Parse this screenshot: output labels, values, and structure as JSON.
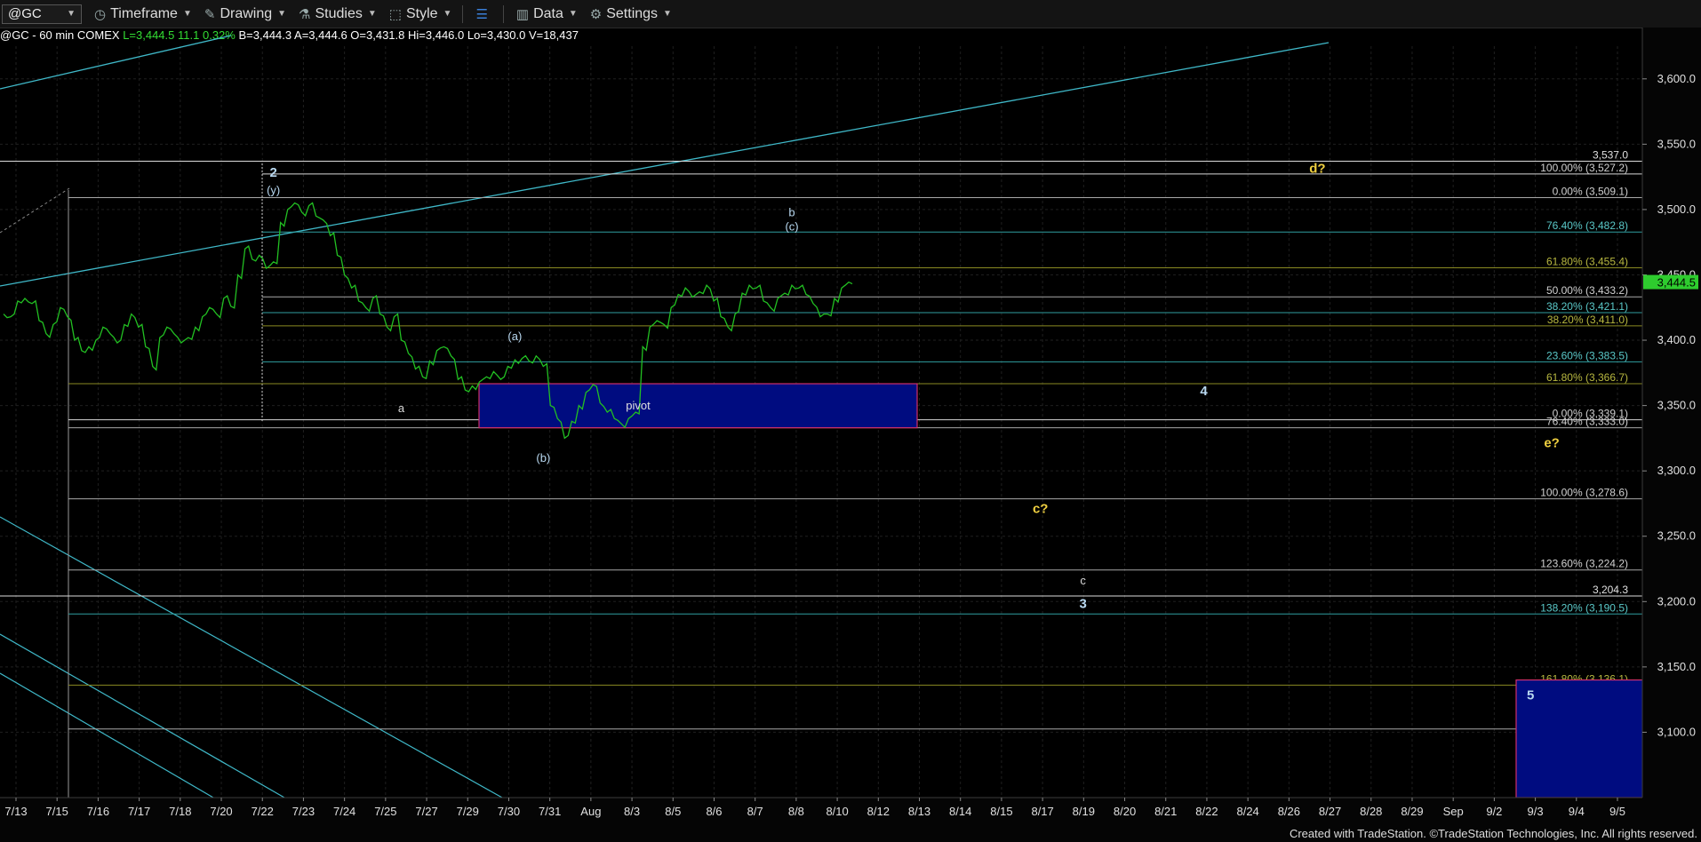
{
  "toolbar": {
    "symbol": "@GC",
    "timeframe": "Timeframe",
    "drawing": "Drawing",
    "studies": "Studies",
    "style": "Style",
    "data": "Data",
    "settings": "Settings"
  },
  "infobar": {
    "title": "@GC - 60 min  COMEX",
    "last": "L=3,444.5",
    "change": "11.1",
    "pct": "0.32%",
    "bid": "B=3,444.3",
    "ask": "A=3,444.6",
    "open": "O=3,431.8",
    "high": "Hi=3,446.0",
    "low": "Lo=3,430.0",
    "volume": "V=18,437"
  },
  "footer": "Created with TradeStation. ©TradeStation Technologies, Inc. All rights reserved.",
  "colors": {
    "price": "#22c022",
    "fib_teal": "#2f9ea0",
    "fib_olive": "#8a8a22",
    "fib_grey": "#a8a8a8",
    "channel": "#3fb8c8",
    "label_yellow": "#f0d040",
    "label_blue": "#b8d8f0",
    "box_fill": "#000c80",
    "box_border": "#d0306a",
    "last_price_bg": "#2ecc2e"
  },
  "chart_data": {
    "type": "line",
    "title": "",
    "ylim": [
      3050,
      3625
    ],
    "y_ticks": [
      "3,600.0",
      "3,550.0",
      "3,500.0",
      "3,450.0",
      "3,400.0",
      "3,350.0",
      "3,300.0",
      "3,250.0",
      "3,200.0",
      "3,150.0",
      "3,100.0"
    ],
    "y_tick_values": [
      3600,
      3550,
      3500,
      3450,
      3400,
      3350,
      3300,
      3250,
      3200,
      3150,
      3100
    ],
    "x_ticks": [
      "7/13",
      "7/15",
      "7/16",
      "7/17",
      "7/18",
      "7/20",
      "7/22",
      "7/23",
      "7/24",
      "7/25",
      "7/27",
      "7/29",
      "7/30",
      "7/31",
      "Aug",
      "8/3",
      "8/5",
      "8/6",
      "8/7",
      "8/8",
      "8/10",
      "8/12",
      "8/13",
      "8/14",
      "8/15",
      "8/17",
      "8/19",
      "8/20",
      "8/21",
      "8/22",
      "8/24",
      "8/26",
      "8/27",
      "8/28",
      "8/29",
      "Sep",
      "9/2",
      "9/3",
      "9/4",
      "9/5"
    ],
    "last_price": 3444.5,
    "last_price_label": "3,444.5",
    "series": [
      {
        "values": [
          3420,
          3418,
          3430,
          3432,
          3428,
          3415,
          3405,
          3412,
          3425,
          3418,
          3400,
          3392,
          3395,
          3400,
          3410,
          3405,
          3398,
          3412,
          3420,
          3410,
          3395,
          3380,
          3402,
          3410,
          3405,
          3398,
          3402,
          3410,
          3418,
          3425,
          3420,
          3432,
          3426,
          3450,
          3470,
          3462,
          3465,
          3455,
          3460,
          3490,
          3500,
          3505,
          3498,
          3503,
          3495,
          3492,
          3480,
          3465,
          3450,
          3440,
          3430,
          3425,
          3432,
          3420,
          3410,
          3418,
          3400,
          3390,
          3378,
          3372,
          3384,
          3392,
          3395,
          3388,
          3370,
          3362,
          3365,
          3368,
          3372,
          3376,
          3370,
          3380,
          3385,
          3386,
          3384,
          3388,
          3380,
          3350,
          3340,
          3325,
          3338,
          3350,
          3360,
          3366,
          3352,
          3345,
          3340,
          3336,
          3340,
          3345,
          3395,
          3410,
          3415,
          3412,
          3425,
          3435,
          3440,
          3433,
          3437,
          3442,
          3430,
          3418,
          3410,
          3420,
          3436,
          3442,
          3440,
          3430,
          3425,
          3432,
          3436,
          3442,
          3440,
          3435,
          3428,
          3418,
          3420,
          3432,
          3440,
          3444.5
        ]
      }
    ],
    "fib_levels": [
      {
        "label": "100.00% (3,527.2)",
        "value": 3527.2,
        "color": "#d8d8d8"
      },
      {
        "label": "0.00% (3,509.1)",
        "value": 3509.1,
        "color": "#a8a8a8"
      },
      {
        "label": "76.40% (3,482.8)",
        "value": 3482.8,
        "color": "#2f9ea0"
      },
      {
        "label": "61.80% (3,455.4)",
        "value": 3455.4,
        "color": "#8a8a22"
      },
      {
        "label": "50.00% (3,433.2)",
        "value": 3433.2,
        "color": "#a8a8a8"
      },
      {
        "label": "38.20% (3,421.1)",
        "value": 3421.1,
        "color": "#2f9ea0"
      },
      {
        "label": "38.20% (3,411.0)",
        "value": 3411.0,
        "color": "#8a8a22"
      },
      {
        "label": "23.60% (3,383.5)",
        "value": 3383.5,
        "color": "#2f9ea0"
      },
      {
        "label": "61.80% (3,366.7)",
        "value": 3366.7,
        "color": "#8a8a22"
      },
      {
        "label": "0.00% (3,339.1)",
        "value": 3339.1,
        "color": "#d8d8d8"
      },
      {
        "label": "76.40% (3,333.0)",
        "value": 3333.0,
        "color": "#a8a8a8"
      },
      {
        "label": "100.00% (3,278.6)",
        "value": 3278.6,
        "color": "#a8a8a8"
      },
      {
        "label": "123.60% (3,224.2)",
        "value": 3224.2,
        "color": "#a8a8a8"
      },
      {
        "label": "138.20% (3,190.5)",
        "value": 3190.5,
        "color": "#2f9ea0"
      },
      {
        "label": "161.80% (3,136.1)",
        "value": 3136.1,
        "color": "#8a8a22"
      },
      {
        "label": "176.40% (3,102.5)",
        "value": 3102.5,
        "color": "#a8a8a8"
      }
    ],
    "price_markers": [
      {
        "label": "3,537.0",
        "value": 3537.0
      },
      {
        "label": "3,204.3",
        "value": 3204.3
      }
    ],
    "annotations": [
      {
        "text": "2",
        "color": "#b8d8f0",
        "bold": true,
        "x_index": 38,
        "y": 3525
      },
      {
        "text": "(y)",
        "color": "#b8d8f0",
        "bold": false,
        "x_index": 38,
        "y": 3512
      },
      {
        "text": "a",
        "color": "#d8d8d8",
        "bold": false,
        "x_index": 56,
        "y": 3345
      },
      {
        "text": "(a)",
        "color": "#b8d8f0",
        "bold": false,
        "x_index": 72,
        "y": 3400
      },
      {
        "text": "(b)",
        "color": "#b8d8f0",
        "bold": false,
        "x_index": 76,
        "y": 3307
      },
      {
        "text": "pivot",
        "color": "#e0e0e0",
        "bold": false,
        "x_index": 86,
        "y": 3347
      },
      {
        "text": "b",
        "color": "#b8d8f0",
        "bold": false,
        "x_index": 111,
        "y": 3495
      },
      {
        "text": "(c)",
        "color": "#b8d8f0",
        "bold": false,
        "x_index": 111,
        "y": 3484
      },
      {
        "text": "d?",
        "color": "#f0d040",
        "bold": true,
        "x_index": 185,
        "y": 3528
      },
      {
        "text": "4",
        "color": "#b8d8f0",
        "bold": true,
        "x_index": 169,
        "y": 3358
      },
      {
        "text": "e?",
        "color": "#f0d040",
        "bold": true,
        "x_index": 218,
        "y": 3318
      },
      {
        "text": "c?",
        "color": "#f0d040",
        "bold": true,
        "x_index": 146,
        "y": 3268
      },
      {
        "text": "c",
        "color": "#d8d8d8",
        "bold": false,
        "x_index": 152,
        "y": 3213
      },
      {
        "text": "3",
        "color": "#b8d8f0",
        "bold": true,
        "x_index": 152,
        "y": 3195
      },
      {
        "text": "5",
        "color": "#b8d8f0",
        "bold": true,
        "x_index": 215,
        "y": 3125
      }
    ],
    "grid": true
  }
}
